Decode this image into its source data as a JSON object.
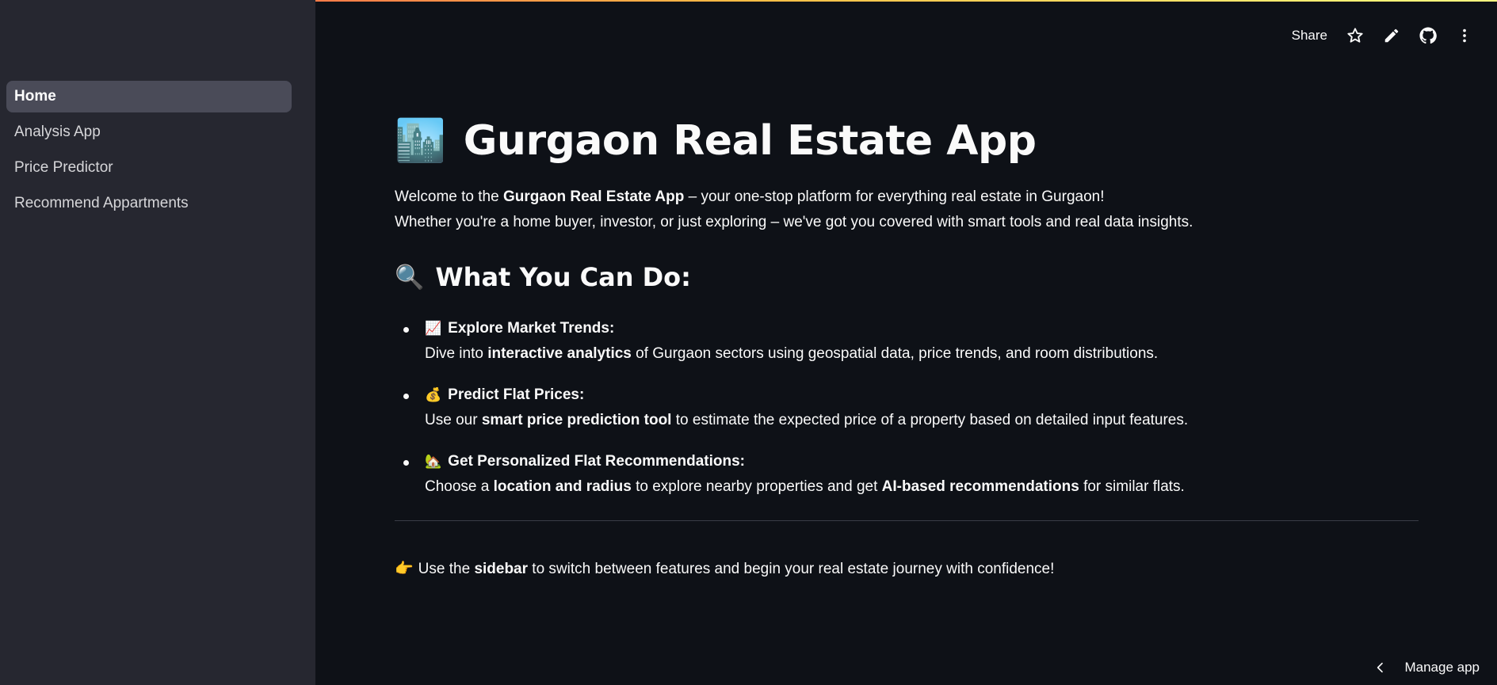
{
  "sidebar": {
    "items": [
      {
        "label": "Home",
        "active": true
      },
      {
        "label": "Analysis App",
        "active": false
      },
      {
        "label": "Price Predictor",
        "active": false
      },
      {
        "label": "Recommend Appartments",
        "active": false
      }
    ]
  },
  "toolbar": {
    "share_label": "Share",
    "icons": [
      "star-icon",
      "pencil-icon",
      "github-icon",
      "more-vertical-icon"
    ]
  },
  "main": {
    "title_emoji": "🏙️",
    "title": "Gurgaon Real Estate App",
    "intro": {
      "line1_pre": "Welcome to the ",
      "line1_bold": "Gurgaon Real Estate App",
      "line1_post": " – your one-stop platform for everything real estate in Gurgaon!",
      "line2": "Whether you're a home buyer, investor, or just exploring – we've got you covered with smart tools and real data insights."
    },
    "section_emoji": "🔍",
    "section_title": "What You Can Do:",
    "features": [
      {
        "emoji": "📈",
        "title": "Explore Market Trends:",
        "pre": "Dive into ",
        "bold1": "interactive analytics",
        "mid": " of Gurgaon sectors using geospatial data, price trends, and room distributions.",
        "bold2": "",
        "post": ""
      },
      {
        "emoji": "💰",
        "title": "Predict Flat Prices:",
        "pre": "Use our ",
        "bold1": "smart price prediction tool",
        "mid": " to estimate the expected price of a property based on detailed input features.",
        "bold2": "",
        "post": ""
      },
      {
        "emoji": "🏡",
        "title": "Get Personalized Flat Recommendations:",
        "pre": "Choose a ",
        "bold1": "location and radius",
        "mid": " to explore nearby properties and get ",
        "bold2": "AI-based recommendations",
        "post": " for similar flats."
      }
    ],
    "cta": {
      "emoji": "👉",
      "pre": "Use the ",
      "bold": "sidebar",
      "post": " to switch between features and begin your real estate journey with confidence!"
    }
  },
  "footer": {
    "manage_label": "Manage app"
  },
  "colors": {
    "background": "#0e1117",
    "sidebar": "#262730",
    "active_nav": "#4a4b58",
    "text": "#fafafa"
  }
}
